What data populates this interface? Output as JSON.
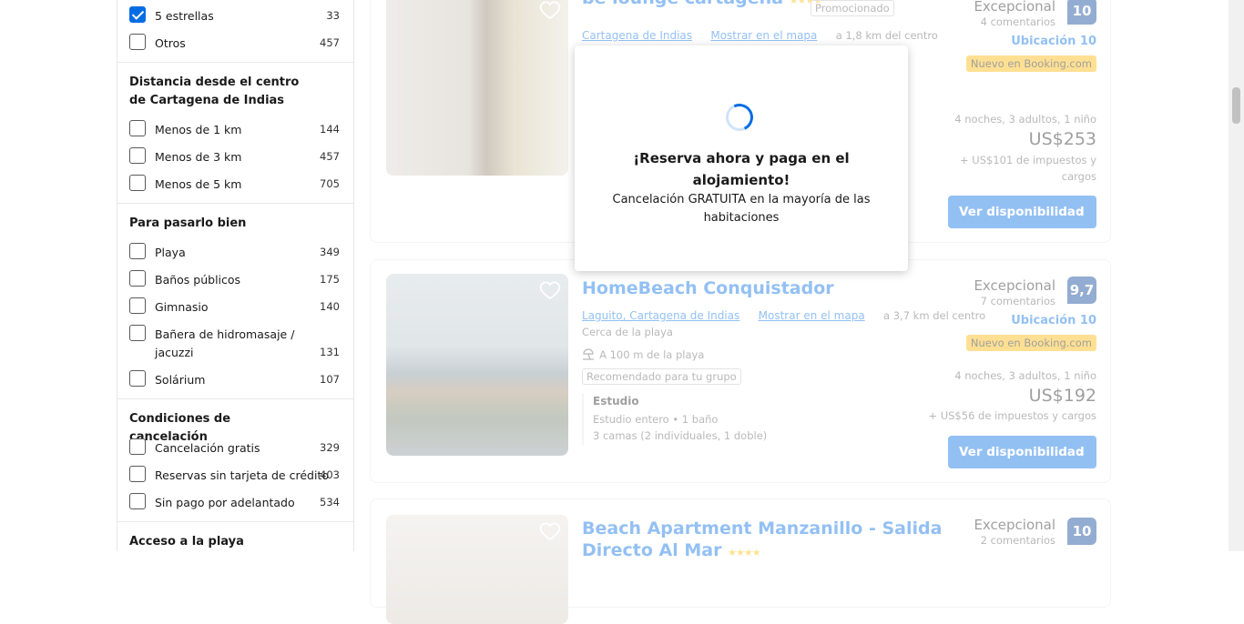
{
  "sidebar": {
    "stars": [
      {
        "label": "5 estrellas",
        "count": "33",
        "checked": true
      },
      {
        "label": "Otros",
        "count": "457",
        "checked": false
      }
    ],
    "distance": {
      "title": "Distancia desde el centro de Cartagena de Indias",
      "items": [
        {
          "label": "Menos de 1 km",
          "count": "144"
        },
        {
          "label": "Menos de 3 km",
          "count": "457"
        },
        {
          "label": "Menos de 5 km",
          "count": "705"
        }
      ]
    },
    "fun": {
      "title": "Para pasarlo bien",
      "items": [
        {
          "label": "Playa",
          "count": "349"
        },
        {
          "label": "Baños públicos",
          "count": "175"
        },
        {
          "label": "Gimnasio",
          "count": "140"
        },
        {
          "label": "Bañera de hidromasaje / jacuzzi",
          "count": "131"
        },
        {
          "label": "Solárium",
          "count": "107"
        }
      ]
    },
    "cancel": {
      "title": "Condiciones de cancelación",
      "items": [
        {
          "label": "Cancelación gratis",
          "count": "329"
        },
        {
          "label": "Reservas sin tarjeta de crédito",
          "count": "403"
        },
        {
          "label": "Sin pago por adelantado",
          "count": "534"
        }
      ]
    },
    "beach_title": "Acceso a la playa"
  },
  "results": [
    {
      "title": "be lounge cartagena",
      "stars": "★★★★",
      "promo": "Promocionado",
      "area_link": "Cartagena de Indias",
      "map_link": "Mostrar en el mapa",
      "distance": "a 1,8 km del centro",
      "rating_label": "Excepcional",
      "reviews": "4 comentarios",
      "score": "10",
      "location": "Ubicación 10",
      "new_badge": "Nuevo en Booking.com",
      "stay": "4 noches, 3 adultos, 1 niño",
      "price": "US$253",
      "taxes": "+ US$101 de impuestos y cargos",
      "cta": "Ver disponibilidad"
    },
    {
      "title": "HomeBeach Conquistador",
      "area_link": "Laguito, Cartagena de Indias",
      "map_link": "Mostrar en el mapa",
      "distance": "a 3,7 km del centro",
      "near": "Cerca de la playa",
      "beach": "A 100 m de la playa",
      "tag": "Recomendado para tu grupo",
      "room_type": "Estudio",
      "room_desc": "Estudio entero • 1 baño",
      "beds": "3 camas (2 individuales, 1 doble)",
      "rating_label": "Excepcional",
      "reviews": "7 comentarios",
      "score": "9,7",
      "location": "Ubicación 10",
      "new_badge": "Nuevo en Booking.com",
      "stay": "4 noches, 3 adultos, 1 niño",
      "price": "US$192",
      "taxes": "+ US$56 de impuestos y cargos",
      "cta": "Ver disponibilidad"
    },
    {
      "title_line1": "Beach Apartment Manzanillo - Salida",
      "title_line2": "Directo Al Mar",
      "stars": "★★★★",
      "rating_label": "Excepcional",
      "reviews": "2 comentarios",
      "score": "10"
    }
  ],
  "modal": {
    "title": "¡Reserva ahora y paga en el alojamiento!",
    "subtitle": "Cancelación GRATUITA en la mayoría de las habitaciones"
  },
  "colors": {
    "brand": "#006ce4",
    "score_bg": "#003b95",
    "badge": "#ffb700",
    "star": "#febb02"
  },
  "icons": [
    "heart-icon",
    "checkmark-icon",
    "beach-icon",
    "chevron-right-icon",
    "spinner-icon"
  ]
}
